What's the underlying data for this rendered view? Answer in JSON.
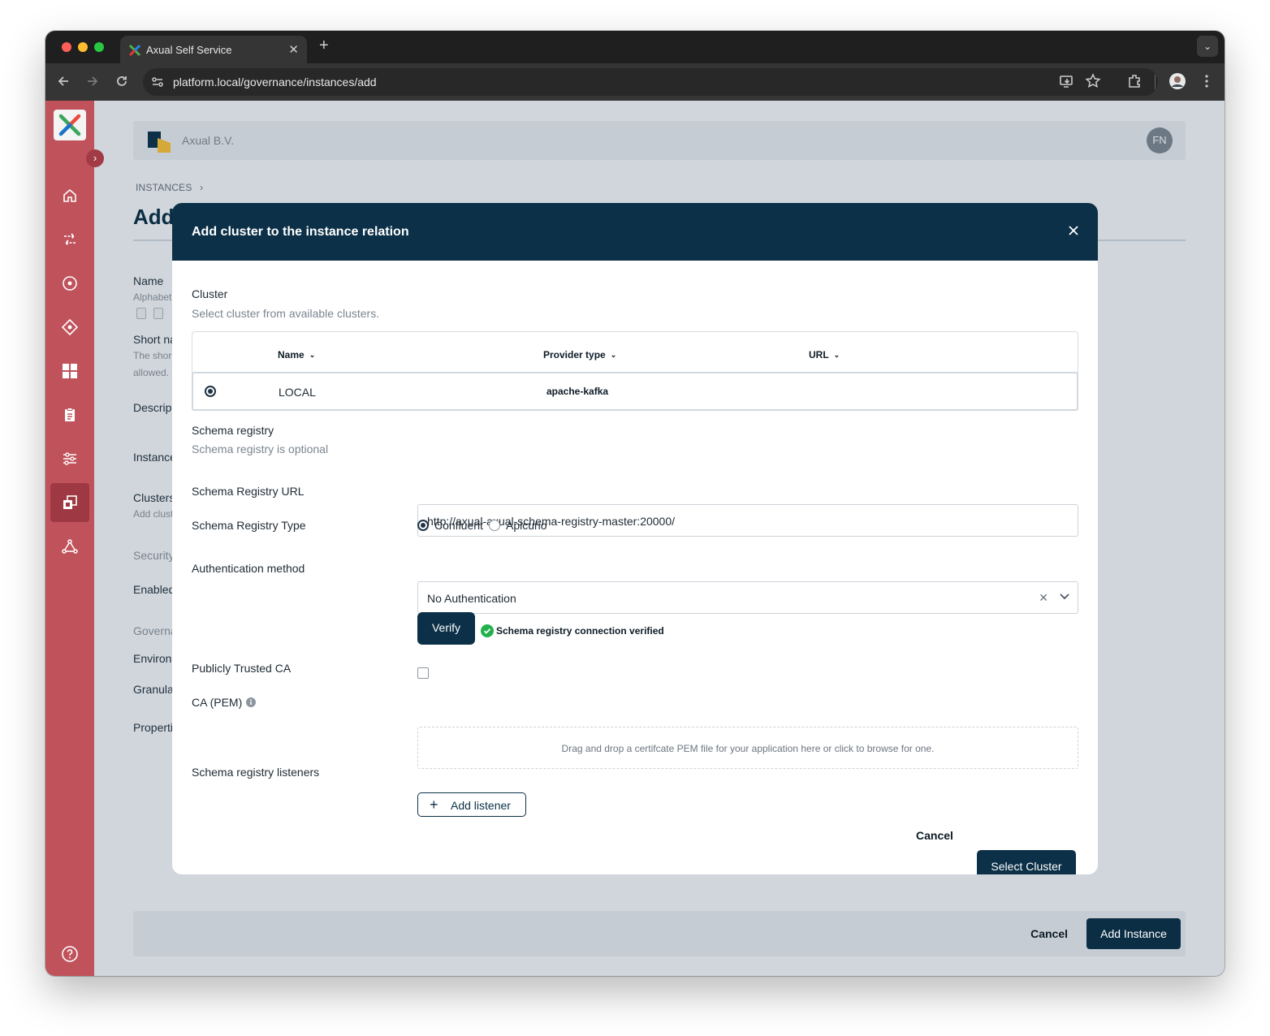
{
  "browser": {
    "tab_title": "Axual Self Service",
    "tab_close": "✕",
    "new_tab": "+",
    "url": "platform.local/governance/instances/add",
    "profile_icon": "avatar-icon"
  },
  "header": {
    "org_name": "Axual B.V.",
    "user_initials": "FN"
  },
  "page": {
    "breadcrumb": "INSTANCES",
    "title": "Add",
    "background_fields": {
      "name_label": "Name",
      "name_hint": "Alphabet",
      "short_label": "Short na",
      "short_hint_1": "The shor",
      "short_hint_2": "allowed.",
      "description_label": "Descript",
      "instance_label": "Instance",
      "clusters_label": "Clusters",
      "clusters_hint": "Add clust",
      "security_heading": "Security",
      "enabled_label": "Enabled",
      "governance_heading": "Governa",
      "environment_label": "Environ",
      "granularity_label": "Granula",
      "properties_label": "Properti"
    }
  },
  "footer": {
    "cancel_label": "Cancel",
    "add_label": "Add Instance"
  },
  "modal": {
    "title": "Add cluster to the instance relation",
    "cluster_title": "Cluster",
    "cluster_subtitle": "Select cluster from available clusters.",
    "table": {
      "columns": [
        "Name",
        "Provider type",
        "URL"
      ],
      "rows": [
        {
          "name": "LOCAL",
          "provider_type": "apache-kafka",
          "url": "",
          "selected": true
        }
      ]
    },
    "schema_title": "Schema registry",
    "schema_subtitle": "Schema registry is optional",
    "schema_url_label": "Schema Registry URL",
    "schema_url_value": "http://axual-axual-schema-registry-master:20000/",
    "schema_type_label": "Schema Registry Type",
    "schema_type_options": [
      "Confluent",
      "Apicurio"
    ],
    "schema_type_selected": "Confluent",
    "auth_label": "Authentication method",
    "auth_value": "No Authentication",
    "verify_label": "Verify",
    "verified_text": "Schema registry connection verified",
    "trusted_ca_label": "Publicly Trusted CA",
    "trusted_ca_checked": false,
    "ca_pem_label": "CA (PEM)",
    "dropzone_text": "Drag and drop a certifcate PEM file for your application here or click to browse for one.",
    "listeners_label": "Schema registry listeners",
    "add_listener_label": "Add listener",
    "cancel_label": "Cancel",
    "select_label": "Select Cluster"
  },
  "colors": {
    "sidebar": "#c0525c",
    "primary": "#0b3047",
    "success": "#22b14c"
  }
}
